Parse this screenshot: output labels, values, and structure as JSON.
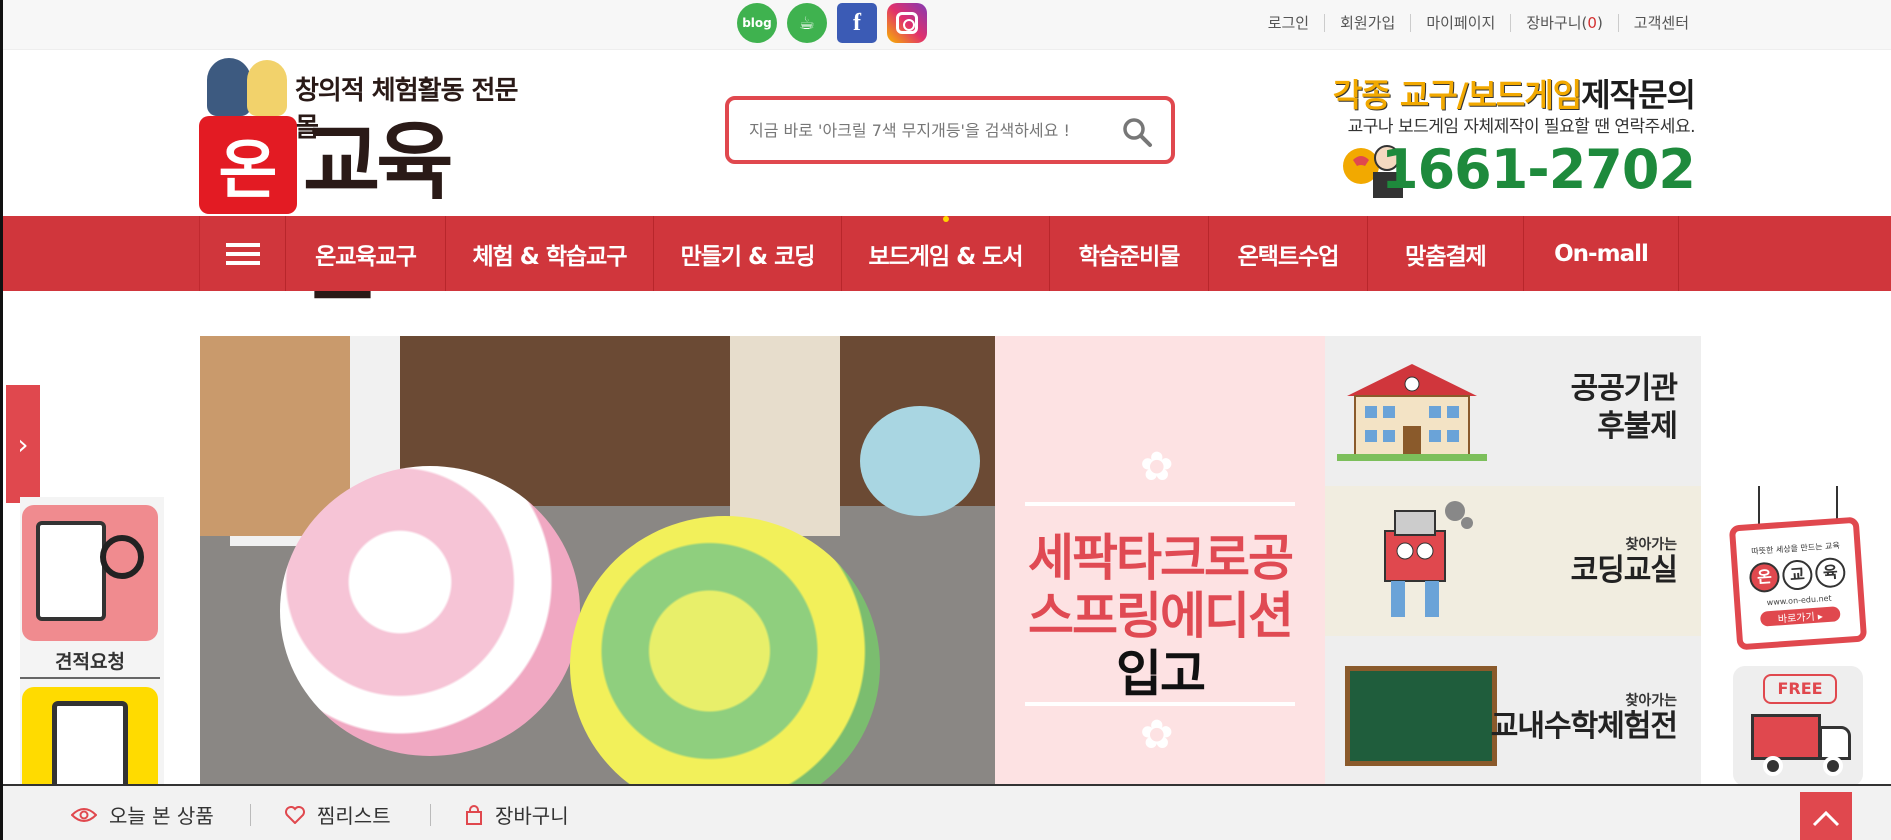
{
  "topbar": {
    "sns": [
      "blog",
      "cafe",
      "f",
      ""
    ],
    "util": [
      {
        "label": "로그인"
      },
      {
        "label": "회원가입"
      },
      {
        "label": "마이페이지"
      },
      {
        "label": "장바구니(",
        "count": "0",
        "suffix": ")"
      },
      {
        "label": "고객센터"
      }
    ]
  },
  "logo": {
    "tagline": "창의적 체험활동 전문몰",
    "badge": "온",
    "brand": "교육몰"
  },
  "search": {
    "placeholder": "지금 바로 '아크릴 7색 무지개등'을 검색하세요 !"
  },
  "promo": {
    "line1_highlight": "각종 교구/보드게임",
    "line1_rest": "제작문의",
    "line2": "교구나 보드게임 자체제작이 필요할 땐 연락주세요.",
    "phone": "1661-2702"
  },
  "nav": {
    "items": [
      "온교육교구",
      "체험 & 학습교구",
      "만들기 & 코딩",
      "보드게임 & 도서",
      "학습준비물",
      "온택트수업",
      "맞춤결제",
      "On-mall"
    ]
  },
  "banners": {
    "pink": {
      "line1": "세팍타크로공",
      "line2": "스프링에디션",
      "line3": "입고"
    },
    "tiles": [
      {
        "small": "",
        "big1": "공공기관",
        "big2": "후불제"
      },
      {
        "small": "찾아가는",
        "big1": "코딩교실",
        "big2": ""
      },
      {
        "small": "찾아가는",
        "big1": "교내수학체험전",
        "big2": ""
      }
    ]
  },
  "left_quick": {
    "label1": "견적요청"
  },
  "right_quick": {
    "sign_top": "따뜻한 세상을 만드는 교육",
    "sign_chars": [
      "온",
      "교",
      "육"
    ],
    "sign_url": "www.on-edu.net",
    "sign_go": "바로가기 ▸",
    "truck_free": "FREE"
  },
  "bottombar": {
    "viewed": "오늘 본 상품",
    "wish": "찜리스트",
    "cart": "장바구니"
  },
  "colors": {
    "accent": "#d0363c",
    "search_border": "#e0484e",
    "phone_green": "#1e8a3c"
  }
}
